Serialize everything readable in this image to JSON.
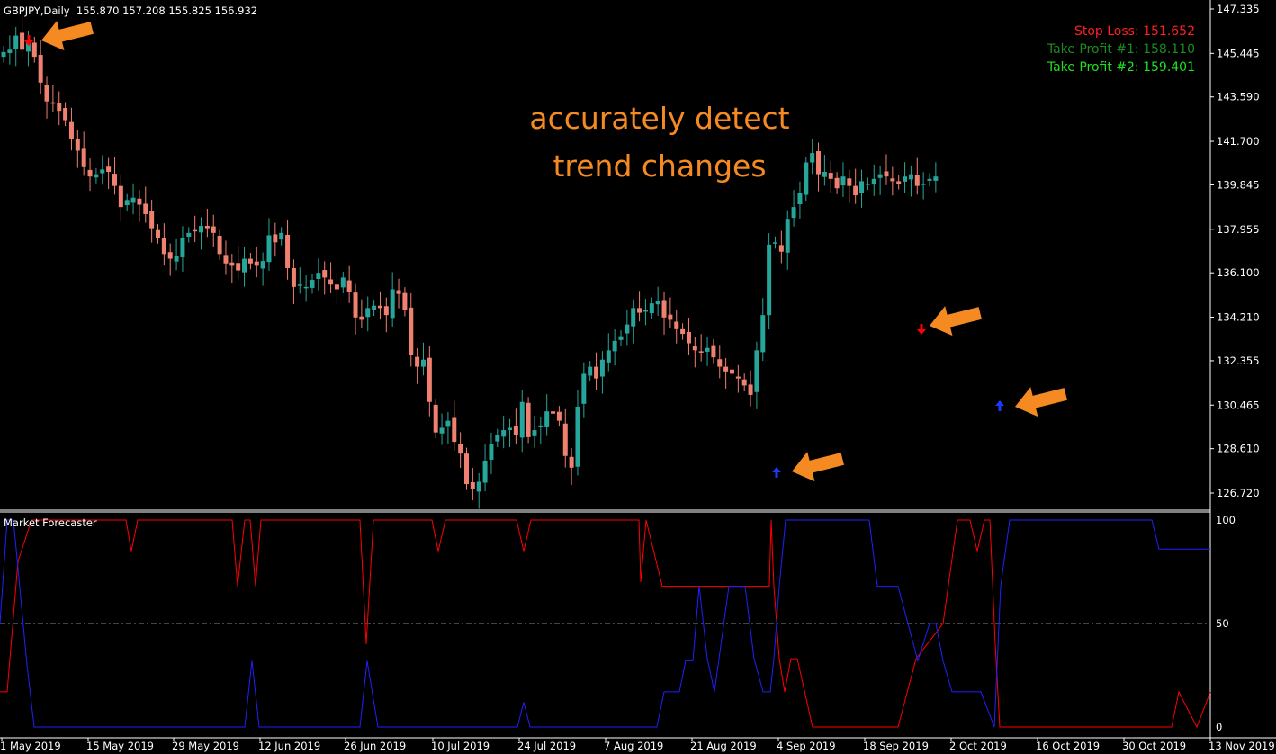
{
  "header": {
    "symbol": "GBPJPY,Daily",
    "ohlc": "155.870 157.208 155.825 156.932"
  },
  "signals_panel": {
    "stop_loss": "Stop Loss: 151.652",
    "take_profit_1": "Take Profit #1: 158.110",
    "take_profit_2": "Take Profit #2: 159.401"
  },
  "promo_text": {
    "line1": "accurately detect",
    "line2": "trend changes"
  },
  "indicator": {
    "title": "Market Forecaster",
    "levels": [
      "100",
      "50",
      "0"
    ]
  },
  "colors": {
    "background": "#000000",
    "bull": "#26a69a",
    "bear": "#f08070",
    "stop_loss": "#ff2020",
    "take_profit_1": "#1e8a1e",
    "take_profit_2": "#20e020",
    "promo": "#f58a22",
    "red_line": "#ff0000",
    "blue_line": "#2020ff",
    "arrow_orange": "#f58a22",
    "signal_down": "#ff0000",
    "signal_up": "#1a3aff"
  },
  "chart_data": {
    "type": "candlestick",
    "price_axis": [
      "147.335",
      "145.445",
      "143.590",
      "141.700",
      "139.845",
      "137.955",
      "136.100",
      "134.210",
      "132.355",
      "130.465",
      "128.610",
      "126.720"
    ],
    "date_axis": [
      "1 May 2019",
      "15 May 2019",
      "29 May 2019",
      "12 Jun 2019",
      "26 Jun 2019",
      "10 Jul 2019",
      "24 Jul 2019",
      "7 Aug 2019",
      "21 Aug 2019",
      "4 Sep 2019",
      "18 Sep 2019",
      "2 Oct 2019",
      "16 Oct 2019",
      "30 Oct 2019",
      "13 Nov 2019"
    ],
    "ylim": [
      126.0,
      147.6
    ],
    "closes": [
      145.5,
      145.6,
      146.2,
      145.6,
      145.9,
      145.3,
      144.2,
      143.4,
      143.3,
      143.0,
      142.6,
      141.8,
      141.3,
      140.6,
      140.2,
      140.3,
      140.5,
      140.4,
      139.8,
      138.9,
      139.2,
      139.3,
      139.0,
      138.6,
      138.0,
      137.6,
      136.9,
      136.7,
      136.8,
      137.6,
      137.8,
      137.9,
      138.1,
      138.0,
      137.8,
      136.9,
      136.5,
      136.4,
      136.2,
      136.7,
      136.5,
      136.4,
      136.6,
      137.7,
      137.4,
      137.8,
      136.3,
      135.5,
      135.6,
      135.5,
      135.8,
      136.1,
      135.9,
      135.6,
      135.4,
      135.9,
      135.3,
      134.2,
      134.1,
      134.6,
      134.7,
      134.6,
      134.3,
      135.4,
      135.2,
      134.5,
      132.6,
      132.1,
      132.4,
      130.6,
      129.3,
      129.5,
      129.8,
      128.9,
      128.4,
      127.1,
      126.9,
      127.2,
      128.1,
      128.8,
      129.2,
      129.4,
      129.5,
      129.2,
      130.6,
      129.1,
      129.4,
      129.6,
      130.2,
      130.1,
      129.8,
      128.3,
      127.8,
      130.4,
      131.8,
      132.1,
      131.6,
      132.4,
      132.8,
      133.2,
      133.4,
      133.9,
      134.6,
      134.4,
      134.5,
      134.8,
      134.9,
      134.2,
      134.1,
      133.7,
      133.5,
      133.1,
      132.8,
      132.7,
      132.9,
      132.5,
      132.1,
      131.9,
      131.8,
      131.6,
      131.3,
      130.9,
      132.8,
      134.3,
      137.3,
      137.4,
      137.0,
      138.4,
      138.9,
      139.5,
      140.8,
      141.2,
      140.3,
      140.4,
      140.1,
      139.7,
      140.2,
      139.8,
      139.4,
      140.0,
      139.9,
      140.1,
      140.3,
      140.2,
      140.0,
      139.9,
      140.2,
      140.3,
      139.8,
      139.9,
      140.1,
      140.2
    ]
  }
}
